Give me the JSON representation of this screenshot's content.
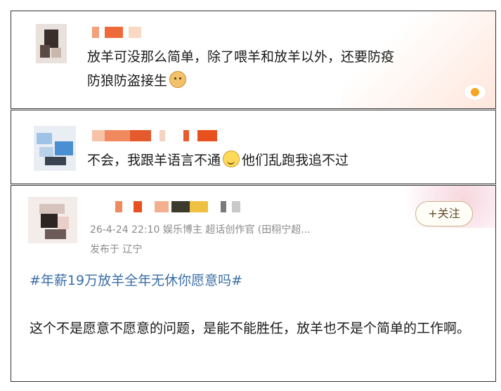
{
  "comments": [
    {
      "text_line1": "放羊可没那么简单，除了喂羊和放羊以外，还要防疫",
      "text_line2": "防狼防盗接生",
      "emoji": "doge-icon"
    },
    {
      "text_before": "不会，我跟羊语言不通",
      "emoji": "smile-icon",
      "text_after": "他们乱跑我追不过"
    }
  ],
  "post": {
    "follow_label": "+关注",
    "meta_line": "26-4-24 22:10  娱乐博主 超话创作官 (田栩宁超...",
    "location": "发布于 辽宁",
    "hashtag": "#年薪19万放羊全年无休你愿意吗#",
    "body": "这个不是愿意不愿意的问题，是能不能胜任，放羊也不是个简单的工作啊。"
  },
  "colors": {
    "hashtag": "#3a6ea5",
    "follow_border": "#c8b38a",
    "text": "#1a1a1a",
    "meta": "#8a8a8a"
  }
}
